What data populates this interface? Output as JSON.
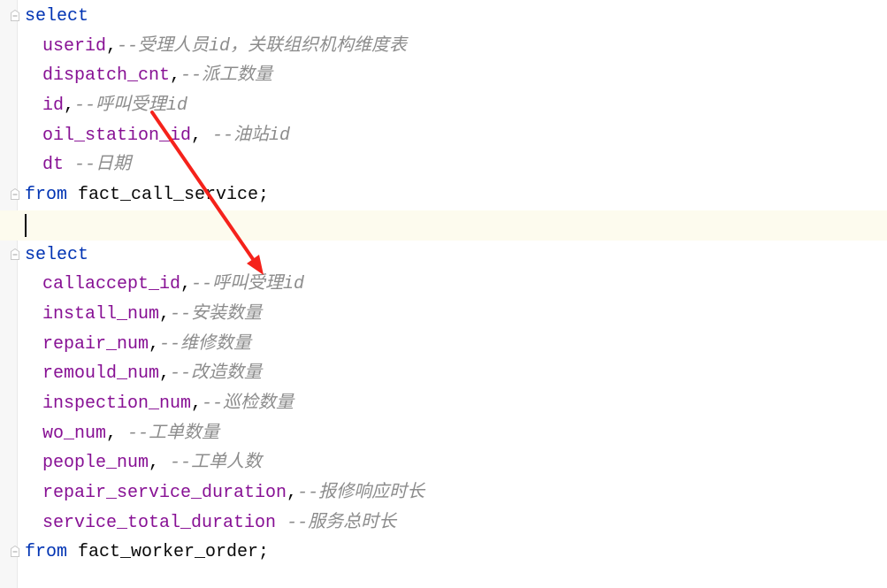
{
  "editor": {
    "lines": [
      {
        "kw": "select",
        "fold": true
      },
      {
        "col": "userid",
        "punct": ",",
        "comment": "--受理人员id，关联组织机构维度表"
      },
      {
        "col": "dispatch_cnt",
        "punct": ",",
        "comment": "--派工数量"
      },
      {
        "col": "id",
        "punct": ",",
        "comment": "--呼叫受理id"
      },
      {
        "col": "oil_station_id",
        "punct": ", ",
        "comment": "--油站id"
      },
      {
        "col": "dt",
        "punct": " ",
        "comment": "--日期"
      },
      {
        "kw": "from",
        "table": " fact_call_service;",
        "fold": true
      },
      {
        "current": true
      },
      {
        "kw": "select",
        "fold": true
      },
      {
        "col": "callaccept_id",
        "punct": ",",
        "comment": "--呼叫受理id"
      },
      {
        "col": "install_num",
        "punct": ",",
        "comment": "--安装数量"
      },
      {
        "col": "repair_num",
        "punct": ",",
        "comment": "--维修数量"
      },
      {
        "col": "remould_num",
        "punct": ",",
        "comment": "--改造数量"
      },
      {
        "col": "inspection_num",
        "punct": ",",
        "comment": "--巡检数量"
      },
      {
        "col": "wo_num",
        "punct": ", ",
        "comment": "--工单数量"
      },
      {
        "col": "people_num",
        "punct": ", ",
        "comment": "--工单人数"
      },
      {
        "col": "repair_service_duration",
        "punct": ",",
        "comment": "--报修响应时长"
      },
      {
        "col": "service_total_duration",
        "punct": " ",
        "comment": "--服务总时长"
      },
      {
        "kw": "from",
        "table": " fact_worker_order;",
        "fold": true
      }
    ]
  },
  "annotation": {
    "type": "arrow",
    "color": "#f5221b"
  },
  "colors": {
    "keyword": "#0033b3",
    "column": "#871094",
    "comment": "#8c8c8c",
    "current_line": "#fdfbee"
  }
}
